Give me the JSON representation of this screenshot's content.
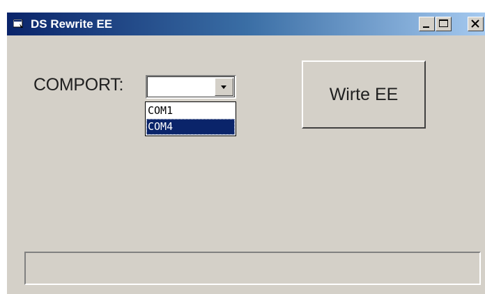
{
  "window": {
    "title": "DS Rewrite EE",
    "icon": "app-window-icon",
    "controls": {
      "minimize": "minimize-icon",
      "maximize": "maximize-icon",
      "close": "close-icon"
    },
    "titlebar_colors": [
      "#0a246a",
      "#a6caf0"
    ]
  },
  "form": {
    "comport_label": "COMPORT:",
    "comport_value": "",
    "comport_options": [
      "COM1",
      "COM4"
    ],
    "comport_highlighted": "COM4",
    "write_button_label": "Wirte EE",
    "status_text": ""
  },
  "colors": {
    "face": "#d4d0c8",
    "selection": "#0a246a"
  }
}
